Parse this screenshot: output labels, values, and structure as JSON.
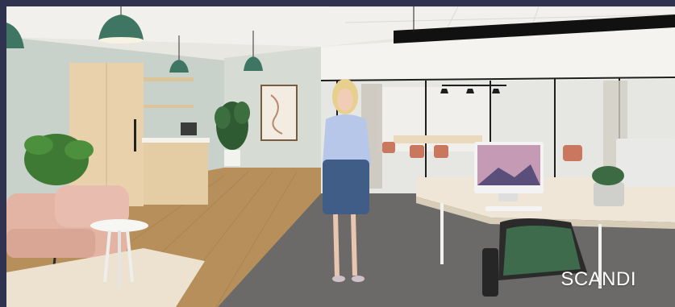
{
  "scene": {
    "caption": "SCANDI",
    "style": "scandinavian office interior rendering",
    "colors": {
      "wall_left": "#cfd6cf",
      "wall_back": "#d8dcd5",
      "ceiling": "#f2f1ee",
      "floor_wood": "#b8915d",
      "rug_grey": "#6e6c6b",
      "pendant_green": "#3f7563",
      "cabinet_oak": "#e6cfa9",
      "desk_top": "#efe7d9",
      "chair_green": "#3e6b4b",
      "armchair_pink": "#e3b3a3",
      "frame_border": "#2f3350"
    }
  }
}
